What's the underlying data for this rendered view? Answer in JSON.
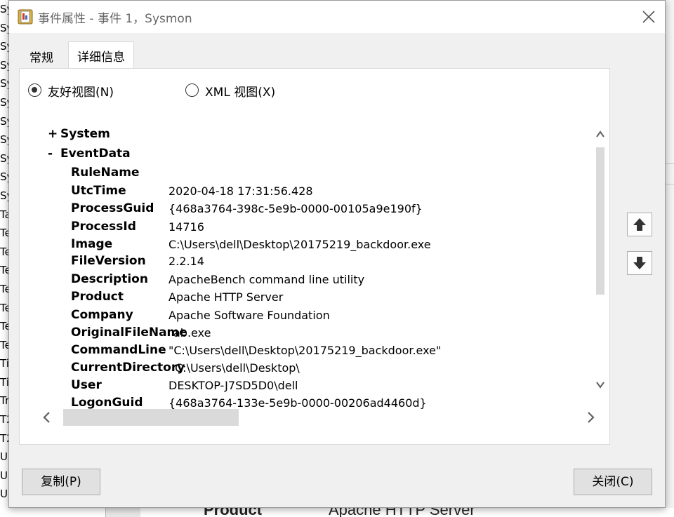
{
  "background": {
    "left_edge_lines": [
      "Sy",
      "Sy",
      "Sy",
      "Sy",
      "Sy",
      "Sy",
      "Sy",
      "Sy",
      "Sy",
      "Sy",
      "Sy",
      "Ta",
      "Te",
      "Te",
      "Te",
      "Te",
      "Te",
      "Te",
      "Te",
      "Ti",
      "Ti",
      "Tr",
      "T2",
      "T2",
      "U",
      "U",
      "U"
    ],
    "bottom_ghost_key": "Product",
    "bottom_ghost_value": "Apache HTTP Server"
  },
  "window": {
    "title": "事件属性 - 事件 1，Sysmon",
    "close_icon": "close-x-icon",
    "app_icon": "event-viewer-icon"
  },
  "tabs": [
    {
      "label": "常规",
      "active": false
    },
    {
      "label": "详细信息",
      "active": true
    }
  ],
  "view_options": {
    "friendly": {
      "label": "友好视图(N)",
      "selected": true
    },
    "xml": {
      "label": "XML 视图(X)",
      "selected": false
    }
  },
  "tree": {
    "system": {
      "sign": "+",
      "label": "System"
    },
    "event_data": {
      "sign": "-",
      "label": "EventData"
    }
  },
  "event_data": [
    {
      "key": "RuleName",
      "value": ""
    },
    {
      "key": "UtcTime",
      "value": "2020-04-18 17:31:56.428"
    },
    {
      "key": "ProcessGuid",
      "value": "{468a3764-398c-5e9b-0000-00105a9e190f}"
    },
    {
      "key": "ProcessId",
      "value": "14716"
    },
    {
      "key": "Image",
      "value": "C:\\Users\\dell\\Desktop\\20175219_backdoor.exe"
    },
    {
      "key": "FileVersion",
      "value": "2.2.14"
    },
    {
      "key": "Description",
      "value": "ApacheBench command line utility"
    },
    {
      "key": "Product",
      "value": "Apache HTTP Server"
    },
    {
      "key": "Company",
      "value": "Apache Software Foundation"
    },
    {
      "key": "OriginalFileName",
      "value": "ab.exe"
    },
    {
      "key": "CommandLine",
      "value": "\"C:\\Users\\dell\\Desktop\\20175219_backdoor.exe\""
    },
    {
      "key": "CurrentDirectory",
      "value": "C:\\Users\\dell\\Desktop\\"
    },
    {
      "key": "User",
      "value": "DESKTOP-J7SD5D0\\dell"
    },
    {
      "key": "LogonGuid",
      "value": "{468a3764-133e-5e9b-0000-00206ad4460d}"
    }
  ],
  "buttons": {
    "copy": "复制(P)",
    "close": "关闭(C)",
    "up_icon": "arrow-up-icon",
    "down_icon": "arrow-down-icon"
  }
}
